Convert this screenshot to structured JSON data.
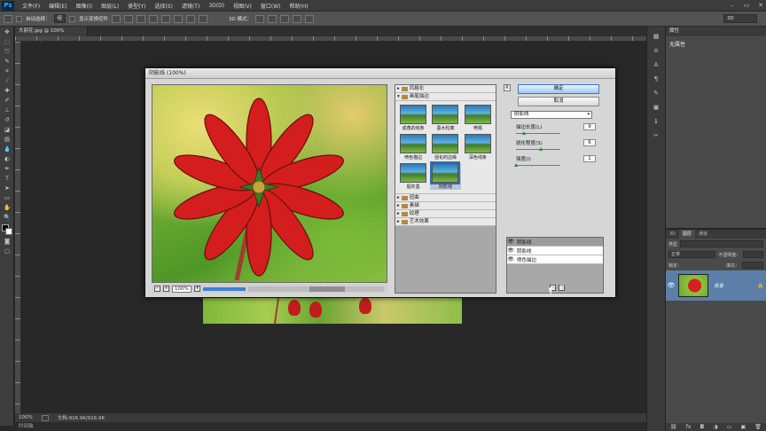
{
  "app": {
    "logo": "Ps"
  },
  "menu": [
    "文件(F)",
    "编辑(E)",
    "图像(I)",
    "图层(L)",
    "类型(Y)",
    "选择(S)",
    "滤镜(T)",
    "3D(D)",
    "视图(V)",
    "窗口(W)",
    "帮助(H)"
  ],
  "window_controls": [
    "–",
    "▭",
    "✕"
  ],
  "options": {
    "auto_select": "自动选择：",
    "auto_select_value": "组",
    "show_transform": "显示变换控件",
    "mode3d": "3D 模式：",
    "workspace": "3D"
  },
  "document": {
    "tab_title": "大丽花.jpg @ 100%(RGB/8#)",
    "zoom": "100%",
    "doc_size": "文档:916.9K/916.9K",
    "bottom_tab": "时间轴"
  },
  "properties": {
    "tab": "属性",
    "title": "无属性"
  },
  "layers": {
    "tabs": [
      "3D",
      "图层",
      "通道"
    ],
    "kind_label": "类型",
    "blend_mode": "正常",
    "opacity_label": "不透明度：",
    "lock_label": "锁定：",
    "fill_label": "填充：",
    "layer_name": "背景"
  },
  "dialog": {
    "title": "阴影线 (100%)",
    "zoom": "100%",
    "ok": "确定",
    "cancel": "取消",
    "collapse": "R",
    "categories_top": [
      "风格化",
      "画笔描边"
    ],
    "filters": [
      "成角的线条",
      "墨水轮廓",
      "喷溅",
      "喷色描边",
      "强化的边缘",
      "深色线条",
      "烟灰墨",
      "阴影线"
    ],
    "categories_bottom": [
      "扭曲",
      "素描",
      "纹理",
      "艺术效果"
    ],
    "selected_filter": "阴影线",
    "params": [
      {
        "label": "描边长度(L)",
        "value": "9",
        "fraction": 0.18
      },
      {
        "label": "锐化程度(S)",
        "value": "6",
        "fraction": 0.55
      },
      {
        "label": "强度(I)",
        "value": "1",
        "fraction": 0.0
      }
    ],
    "effect_layers": [
      "阴影线",
      "阴影线",
      "喷色描边"
    ]
  },
  "colors": {
    "accent": "#3d7fd8",
    "layer_selected": "#5b7fa8",
    "flower_red": "#d42020"
  }
}
